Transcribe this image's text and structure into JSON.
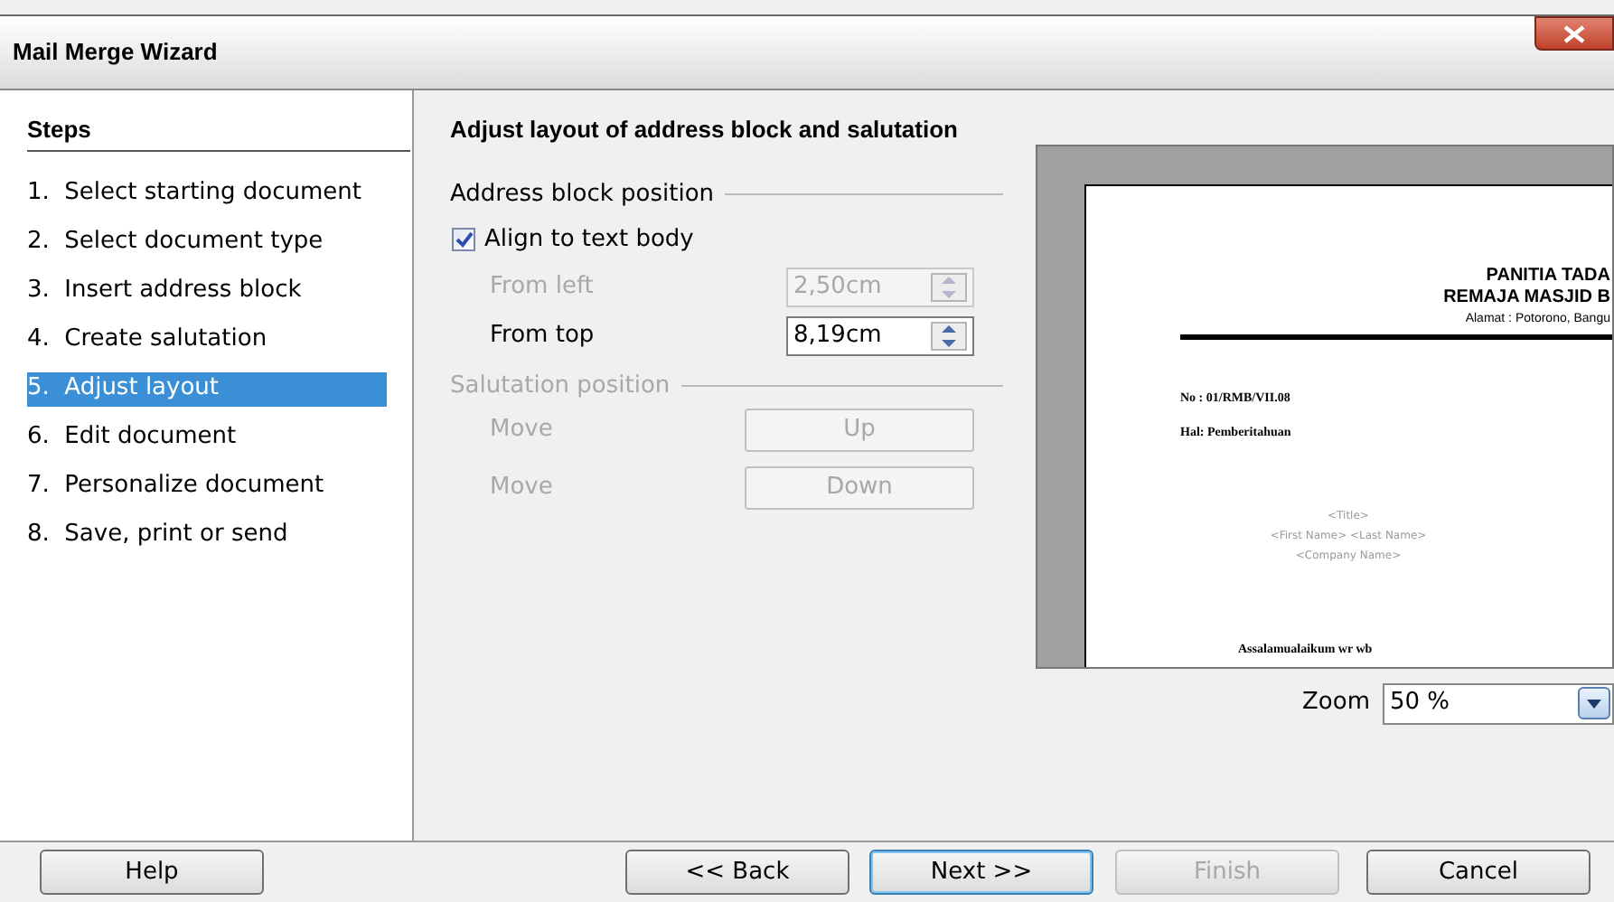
{
  "window": {
    "title": "Mail Merge Wizard"
  },
  "steps": {
    "title": "Steps",
    "items": [
      {
        "number": "1.",
        "label": "Select starting document",
        "selected": false
      },
      {
        "number": "2.",
        "label": "Select document type",
        "selected": false
      },
      {
        "number": "3.",
        "label": "Insert address block",
        "selected": false
      },
      {
        "number": "4.",
        "label": "Create salutation",
        "selected": false
      },
      {
        "number": "5.",
        "label": "Adjust layout",
        "selected": true
      },
      {
        "number": "6.",
        "label": "Edit document",
        "selected": false
      },
      {
        "number": "7.",
        "label": "Personalize document",
        "selected": false
      },
      {
        "number": "8.",
        "label": "Save, print or send",
        "selected": false
      }
    ]
  },
  "page": {
    "title": "Adjust layout of address block and salutation",
    "address_block": {
      "title": "Address block position",
      "align_checkbox": {
        "label": "Align to text body",
        "checked": true
      },
      "fields": [
        {
          "label": "From left",
          "value": "2,50cm",
          "disabled": true
        },
        {
          "label": "From top",
          "value": "8,19cm",
          "disabled": false
        }
      ]
    },
    "salutation": {
      "title": "Salutation position",
      "disabled": true,
      "rows": [
        {
          "label": "Move",
          "button": "Up"
        },
        {
          "label": "Move",
          "button": "Down"
        }
      ]
    },
    "preview": {
      "heading_lines": [
        "PANITIA TADA",
        "REMAJA MASJID B"
      ],
      "address": "Alamat : Potorono, Bangu",
      "letter_lines": [
        "No  : 01/RMB/VII.08",
        "Hal: Pemberitahuan"
      ],
      "placeholders": [
        "<Title>",
        "<First Name> <Last Name>",
        "<Company Name>"
      ],
      "greeting": "Assalamualaikum wr wb"
    },
    "zoom": {
      "label": "Zoom",
      "value": "50 %"
    }
  },
  "buttons": [
    {
      "label": "Help",
      "disabled": false,
      "default": false
    },
    {
      "label": "<< Back",
      "disabled": false,
      "default": false
    },
    {
      "label": "Next >>",
      "disabled": false,
      "default": true
    },
    {
      "label": "Finish",
      "disabled": true,
      "default": false
    },
    {
      "label": "Cancel",
      "disabled": false,
      "default": false
    }
  ]
}
